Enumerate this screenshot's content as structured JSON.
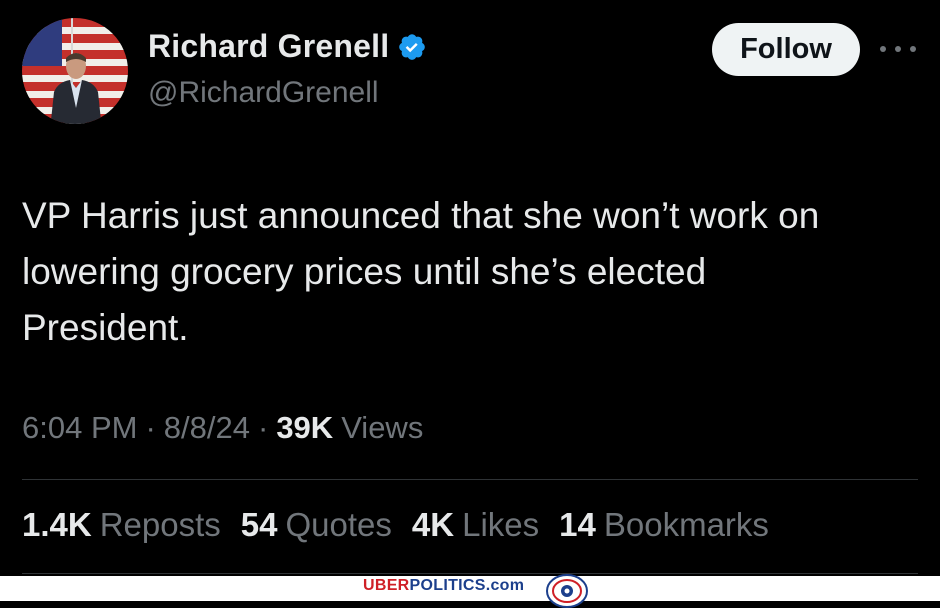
{
  "author": {
    "display_name": "Richard Grenell",
    "handle": "@RichardGrenell",
    "verified_icon": "verified-badge-icon"
  },
  "follow_label": "Follow",
  "more_icon": "more-options-icon",
  "tweet_text_lines": [
    "VP Harris just announced that she won’t work on",
    "lowering grocery prices until she’s elected",
    "President."
  ],
  "meta": {
    "time": "6:04 PM",
    "sep1": "·",
    "date": "8/8/24",
    "sep2": "·",
    "views_count": "39K",
    "views_label": "Views"
  },
  "stats": [
    {
      "value": "1.4K",
      "label": "Reposts"
    },
    {
      "value": "54",
      "label": "Quotes"
    },
    {
      "value": "4K",
      "label": "Likes"
    },
    {
      "value": "14",
      "label": "Bookmarks"
    }
  ],
  "watermark": {
    "part1": "UBER",
    "part2": "POLITICS",
    "part3": ".com"
  },
  "colors": {
    "background": "#000000",
    "text": "#e7e9ea",
    "muted": "#71767b",
    "verified": "#1d9bf0",
    "follow_bg": "#eff3f4"
  }
}
